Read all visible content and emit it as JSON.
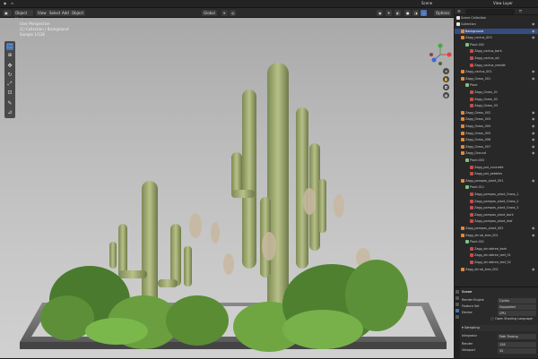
{
  "menubar": {
    "scene_label": "Scene",
    "view_layer_label": "View Layer"
  },
  "viewport_header": {
    "mode": "Object Mode",
    "menus": [
      "View",
      "Select",
      "Add",
      "Object"
    ],
    "transform": "Global",
    "options": "Options"
  },
  "viewport_overlay": {
    "lines": [
      "User Perspective",
      "(1) Collection | Background",
      "Sample 1/128"
    ]
  },
  "outliner": {
    "title": "Scene Collection",
    "items": [
      {
        "label": "Collection",
        "indent": 0,
        "selected": false
      },
      {
        "label": "Background",
        "indent": 1,
        "selected": true
      },
      {
        "label": "Zagg_cactus_003",
        "indent": 1,
        "selected": false
      },
      {
        "label": "Plant.002",
        "indent": 2,
        "selected": false
      },
      {
        "label": "Zagg_cactus_bark",
        "indent": 3,
        "selected": false
      },
      {
        "label": "Zagg_cactus_ski",
        "indent": 3,
        "selected": false
      },
      {
        "label": "Zagg_cactus_needle",
        "indent": 3,
        "selected": false
      },
      {
        "label": "Zagg_cactus_001",
        "indent": 1,
        "selected": false
      },
      {
        "label": "Zagg_Grass_001",
        "indent": 1,
        "selected": false
      },
      {
        "label": "Plant",
        "indent": 2,
        "selected": false
      },
      {
        "label": "Zagg_Grass_01",
        "indent": 3,
        "selected": false
      },
      {
        "label": "Zagg_Grass_02",
        "indent": 3,
        "selected": false
      },
      {
        "label": "Zagg_Grass_03",
        "indent": 3,
        "selected": false
      },
      {
        "label": "Zagg_Grass_002",
        "indent": 1,
        "selected": false
      },
      {
        "label": "Zagg_Grass_003",
        "indent": 1,
        "selected": false
      },
      {
        "label": "Zagg_Grass_004",
        "indent": 1,
        "selected": false
      },
      {
        "label": "Zagg_Grass_005",
        "indent": 1,
        "selected": false
      },
      {
        "label": "Zagg_Grass_006",
        "indent": 1,
        "selected": false
      },
      {
        "label": "Zagg_Grass_007",
        "indent": 1,
        "selected": false
      },
      {
        "label": "Zagg_Ground",
        "indent": 1,
        "selected": false
      },
      {
        "label": "Plant.003",
        "indent": 2,
        "selected": false
      },
      {
        "label": "Zagg_pot_concrete",
        "indent": 3,
        "selected": false
      },
      {
        "label": "Zagg_pot_pebbles",
        "indent": 3,
        "selected": false
      },
      {
        "label": "Zagg_pampas_plant_001",
        "indent": 1,
        "selected": false
      },
      {
        "label": "Plant.011",
        "indent": 2,
        "selected": false
      },
      {
        "label": "Zagg_pampas_plant_Grass_1",
        "indent": 3,
        "selected": false
      },
      {
        "label": "Zagg_pampas_plant_Grass_2",
        "indent": 3,
        "selected": false
      },
      {
        "label": "Zagg_pampas_plant_Grass_3",
        "indent": 3,
        "selected": false
      },
      {
        "label": "Zagg_pampas_plant_bark",
        "indent": 3,
        "selected": false
      },
      {
        "label": "Zagg_pampas_plant_leaf",
        "indent": 3,
        "selected": false
      },
      {
        "label": "Zagg_pampas_plant_002",
        "indent": 1,
        "selected": false
      },
      {
        "label": "Zagg_shrub_tree_001",
        "indent": 1,
        "selected": false
      },
      {
        "label": "Plant.001",
        "indent": 2,
        "selected": false
      },
      {
        "label": "Zagg_shrubtree_bark",
        "indent": 3,
        "selected": false
      },
      {
        "label": "Zagg_shrubtree_leaf_01",
        "indent": 3,
        "selected": false
      },
      {
        "label": "Zagg_shrubtree_leaf_02",
        "indent": 3,
        "selected": false
      },
      {
        "label": "Zagg_shrub_tree_002",
        "indent": 1,
        "selected": false
      }
    ]
  },
  "properties": {
    "header": "Scene",
    "render_engine_label": "Render Engine",
    "render_engine": "Cycles",
    "feature_set_label": "Feature Set",
    "feature_set": "Supported",
    "device_label": "Device",
    "device": "CPU",
    "osl_label": "Open Shading Language",
    "sampling_section": "Sampling",
    "integrator_label": "Integrator",
    "integrator": "Path Tracing",
    "render_label": "Render",
    "render_samples": "128",
    "viewport_label": "Viewport",
    "viewport_samples": "32"
  },
  "colors": {
    "accent": "#4772b3",
    "selected_row": "#334d80",
    "collection": "#e8e8e8",
    "object": "#e08a3a",
    "mesh": "#7fc27f",
    "material": "#c0504d"
  }
}
